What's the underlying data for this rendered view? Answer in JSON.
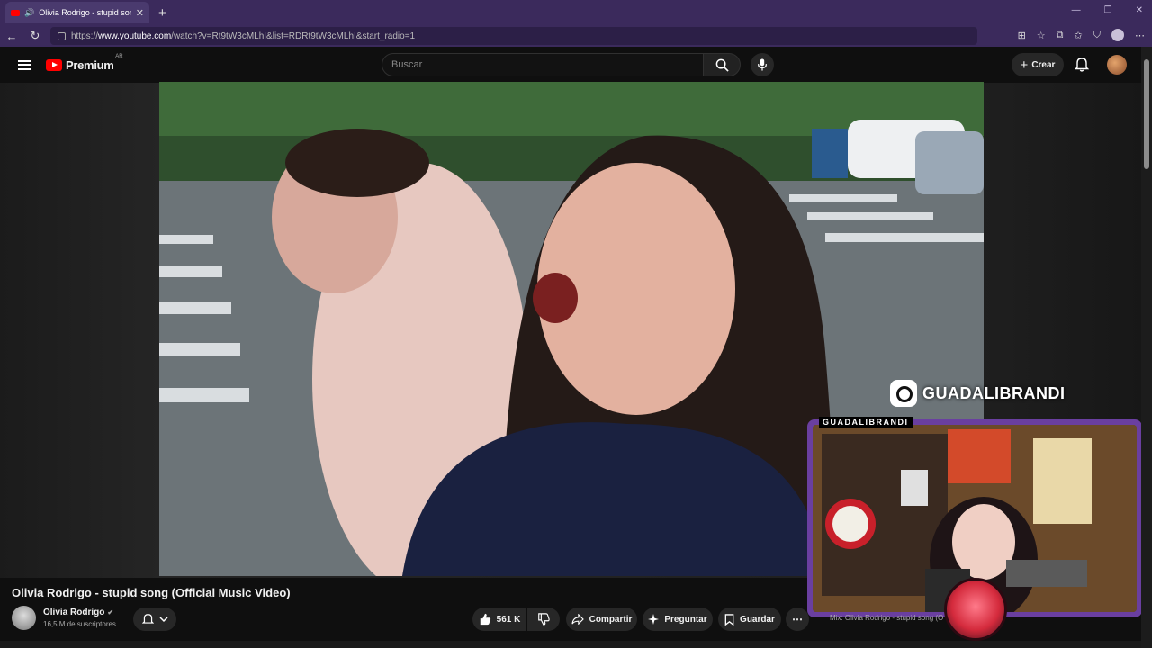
{
  "browser": {
    "tab": {
      "title": "Olivia Rodrigo - stupid song (",
      "close": "✕"
    },
    "new_tab": "+",
    "window_controls": [
      "—",
      "❐",
      "✕"
    ],
    "url_prefix": "https://",
    "url_host": "www.youtube.com",
    "url_path": "/watch?v=Rt9tW3cMLhI&list=RDRt9tW3cMLhI&start_radio=1"
  },
  "masthead": {
    "logo_text": "Premium",
    "country_code": "AR",
    "search_placeholder": "Buscar",
    "create_label": "Crear"
  },
  "video": {
    "title": "Olivia Rodrigo - stupid song (Official Music Video)",
    "channel_name": "Olivia Rodrigo",
    "subscribers": "16,5 M de suscriptores",
    "likes": "561 K",
    "share_label": "Compartir",
    "ask_label": "Preguntar",
    "save_label": "Guardar"
  },
  "overlay": {
    "instagram_handle": "GUADALIBRANDI",
    "webcam_label": "GUADALIBRANDI",
    "mix_text": "Mix: Olivia Rodrigo - stupid song (O"
  },
  "colors": {
    "accent": "#ff0000",
    "browser_chrome": "#3b2a5c",
    "webcam_border": "#6a3fa0"
  }
}
